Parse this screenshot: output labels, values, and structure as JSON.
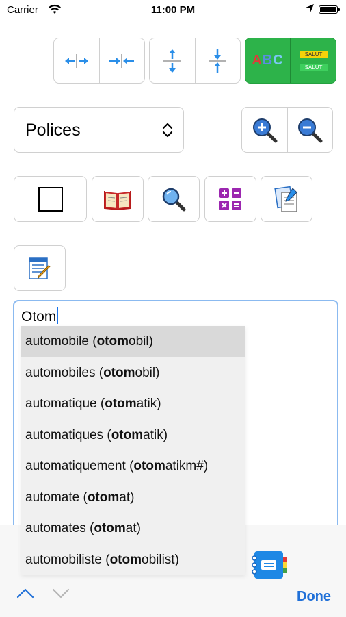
{
  "status_bar": {
    "carrier": "Carrier",
    "time": "11:00 PM"
  },
  "font_select": {
    "label": "Polices"
  },
  "editor": {
    "text": "Otom"
  },
  "spacing_buttons": {
    "abc_label": "ABC",
    "salut_top": "SALUT",
    "salut_bottom": "SALUT"
  },
  "suggestions": [
    {
      "word": "automobile (",
      "bold": "otom",
      "rest": "obil)"
    },
    {
      "word": "automobiles (",
      "bold": "otom",
      "rest": "obil)"
    },
    {
      "word": "automatique (",
      "bold": "otom",
      "rest": "atik)"
    },
    {
      "word": "automatiques (",
      "bold": "otom",
      "rest": "atik)"
    },
    {
      "word": "automatiquement (",
      "bold": "otom",
      "rest": "atikm#)"
    },
    {
      "word": "automate (",
      "bold": "otom",
      "rest": "at)"
    },
    {
      "word": "automates (",
      "bold": "otom",
      "rest": "at)"
    },
    {
      "word": "automobiliste (",
      "bold": "otom",
      "rest": "obilist)"
    }
  ],
  "keyboard_toolbar": {
    "done_label": "Done"
  },
  "colors": {
    "accent": "#2070d8",
    "green": "#2db34a",
    "blue_icon": "#2a8ee8"
  },
  "icons": [
    "wifi-icon",
    "location-icon",
    "battery-icon",
    "expand-horizontal-icon",
    "compress-horizontal-icon",
    "expand-vertical-icon",
    "compress-vertical-icon",
    "zoom-in-icon",
    "zoom-out-icon",
    "square-icon",
    "book-icon",
    "magnifier-icon",
    "calculator-icon",
    "documents-icon",
    "notepad-icon",
    "chevron-up-icon",
    "chevron-down-icon",
    "notebook-icon"
  ]
}
